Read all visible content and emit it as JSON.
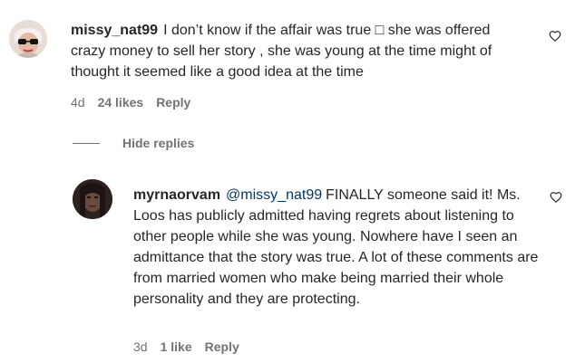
{
  "comments": [
    {
      "username": "missy_nat99",
      "text": "I don’t know if the affair was true □ she was offered crazy money to sell her story , she was young at the time might of thought it seemed like a good idea at the time",
      "age": "4d",
      "likes": "24 likes",
      "reply_label": "Reply",
      "like_icon": "heart-outline"
    },
    {
      "username": "myrnaorvam",
      "mention": "@missy_nat99",
      "text": "FINALLY someone said it! Ms. Loos has publicly admitted having regrets about listening to other people while she was young. Nowhere have I seen an admittance that the story was true. A lot of these comments are from married women who make being married their whole personality and they are protecting.",
      "age": "3d",
      "likes": "1 like",
      "reply_label": "Reply",
      "like_icon": "heart-outline"
    }
  ],
  "replies_toggle": {
    "label": "Hide replies"
  },
  "colors": {
    "text": "#262626",
    "muted": "#737373",
    "mention": "#00376b"
  }
}
